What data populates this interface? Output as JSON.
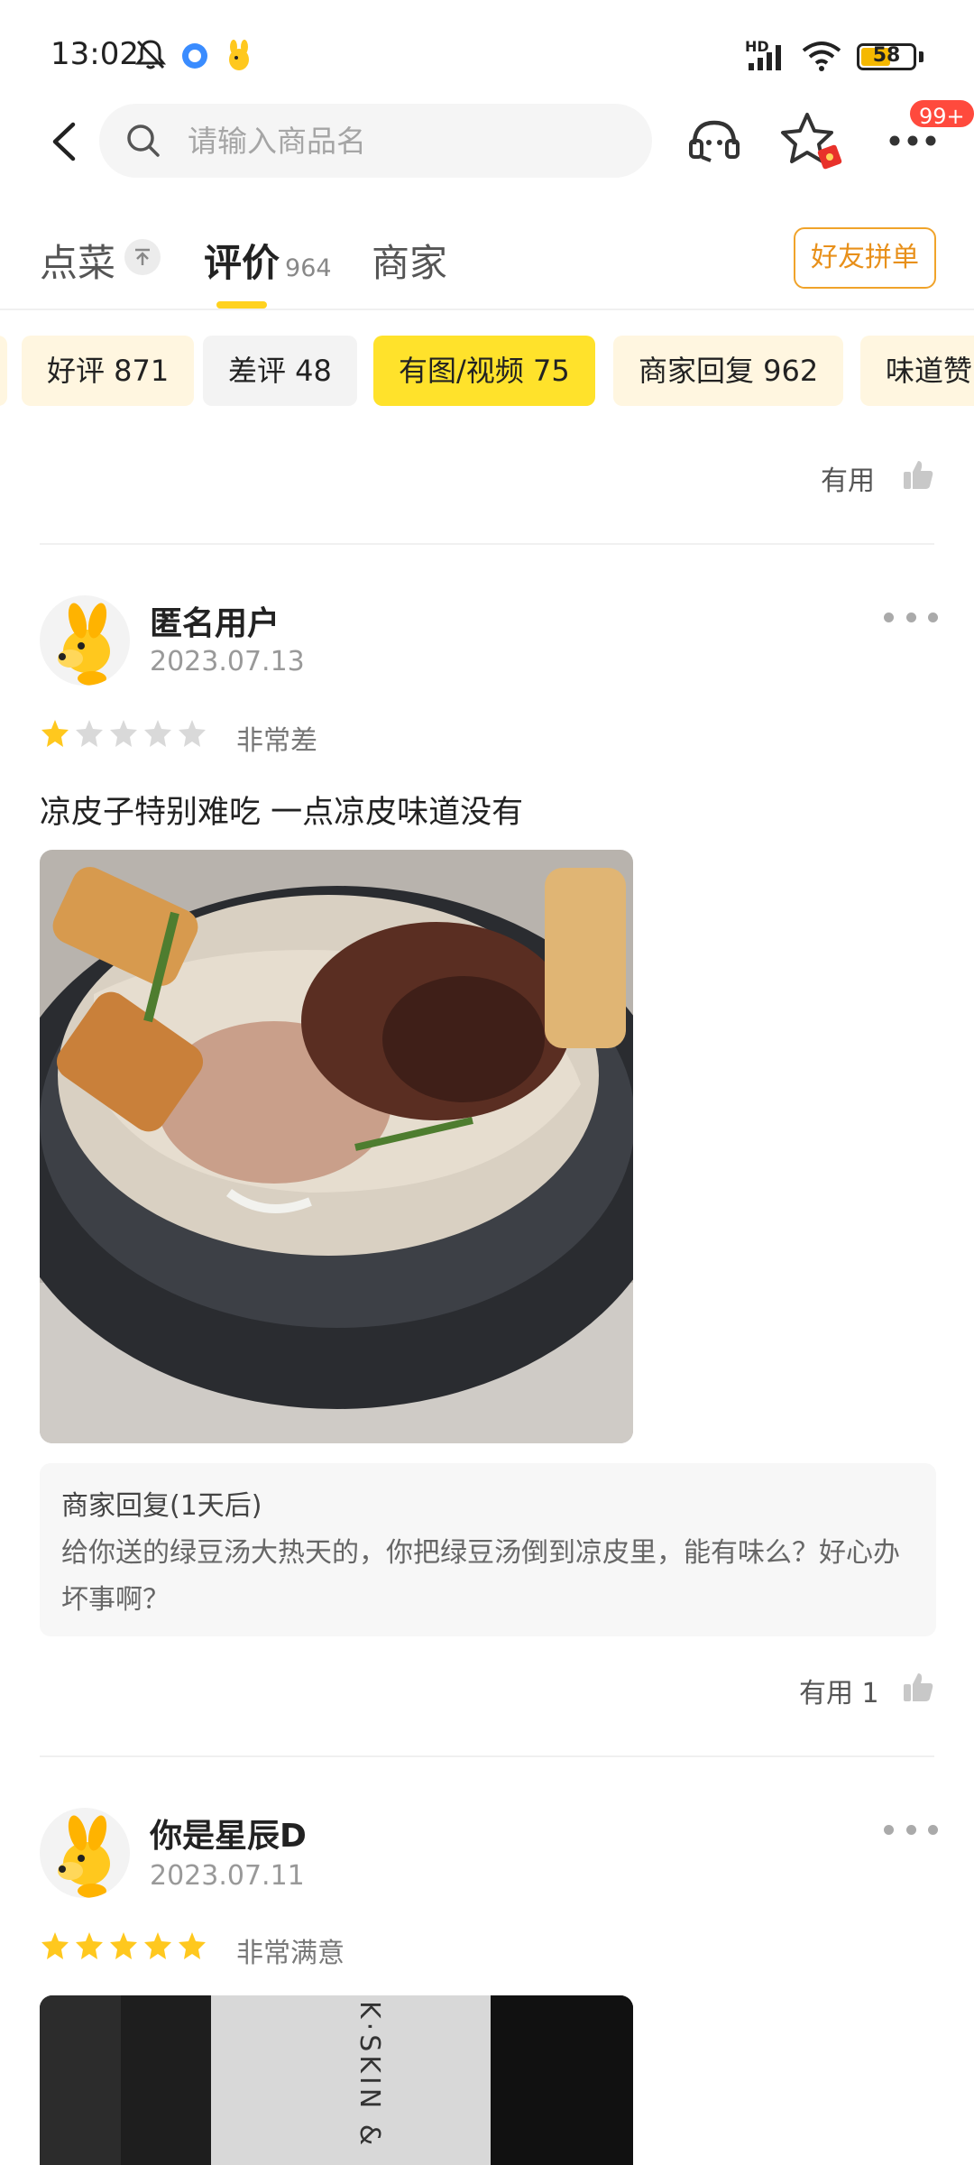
{
  "status_bar": {
    "time": "13:02",
    "battery": "58",
    "battery_level": 0.58,
    "network_label": "HD"
  },
  "search": {
    "placeholder": "请输入商品名"
  },
  "header": {
    "badge": "99+"
  },
  "tabs": [
    {
      "label": "点菜",
      "count": ""
    },
    {
      "label": "评价",
      "count": "964"
    },
    {
      "label": "商家",
      "count": ""
    }
  ],
  "friend_button": "好友拼单",
  "filters": [
    {
      "label": "好评 871"
    },
    {
      "label": "差评 48"
    },
    {
      "label": "有图/视频 75"
    },
    {
      "label": "商家回复 962"
    },
    {
      "label": "味道赞"
    }
  ],
  "top_useful": "有用",
  "reviews": [
    {
      "user": "匿名用户",
      "date": "2023.07.13",
      "stars": 1,
      "rating_label": "非常差",
      "text": "凉皮子特别难吃 一点凉皮味道没有",
      "reply_title": "商家回复(1天后)",
      "reply_text": "给你送的绿豆汤大热天的，你把绿豆汤倒到凉皮里，能有味么？好心办坏事啊？",
      "useful": "有用 1"
    },
    {
      "user": "你是星辰D",
      "date": "2023.07.11",
      "stars": 5,
      "rating_label": "非常满意",
      "photo_text": "K·SKIN &"
    }
  ],
  "colors": {
    "accent": "#ffe22b",
    "star": "#ffc81e",
    "star_empty": "#d9d9d9",
    "friend_button": "#e8901a",
    "badge": "#ff4a3d"
  }
}
